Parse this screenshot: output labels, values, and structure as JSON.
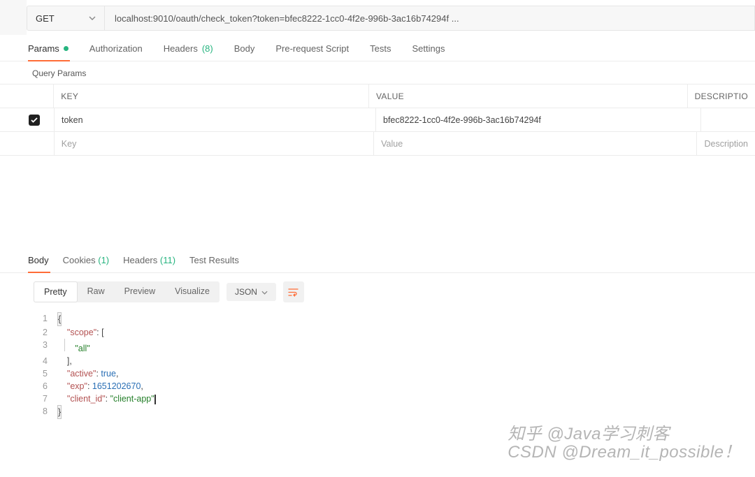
{
  "request": {
    "method": "GET",
    "url": "localhost:9010/oauth/check_token?token=bfec8222-1cc0-4f2e-996b-3ac16b74294f ..."
  },
  "tabs": {
    "params": "Params",
    "authorization": "Authorization",
    "headers": "Headers",
    "headers_count": "(8)",
    "body": "Body",
    "prerequest": "Pre-request Script",
    "tests": "Tests",
    "settings": "Settings"
  },
  "section_title": "Query Params",
  "params_header": {
    "key": "KEY",
    "value": "VALUE",
    "desc": "DESCRIPTIO"
  },
  "params": [
    {
      "enabled": true,
      "key": "token",
      "value": "bfec8222-1cc0-4f2e-996b-3ac16b74294f",
      "description": ""
    }
  ],
  "params_placeholder": {
    "key": "Key",
    "value": "Value",
    "desc": "Description"
  },
  "response_tabs": {
    "body": "Body",
    "cookies": "Cookies",
    "cookies_count": "(1)",
    "headers": "Headers",
    "headers_count": "(11)",
    "test_results": "Test Results"
  },
  "view_tabs": {
    "pretty": "Pretty",
    "raw": "Raw",
    "preview": "Preview",
    "visualize": "Visualize",
    "format": "JSON"
  },
  "code_lines": [
    "1",
    "2",
    "3",
    "4",
    "5",
    "6",
    "7",
    "8"
  ],
  "json_body": {
    "scope_key": "\"scope\"",
    "scope_val": "\"all\"",
    "active_key": "\"active\"",
    "active_val": "true",
    "exp_key": "\"exp\"",
    "exp_val": "1651202670",
    "client_id_key": "\"client_id\"",
    "client_id_val": "\"client-app\""
  },
  "watermark": {
    "line1": "知乎 @Java学习刺客",
    "line2": "CSDN @Dream_it_possible！"
  }
}
